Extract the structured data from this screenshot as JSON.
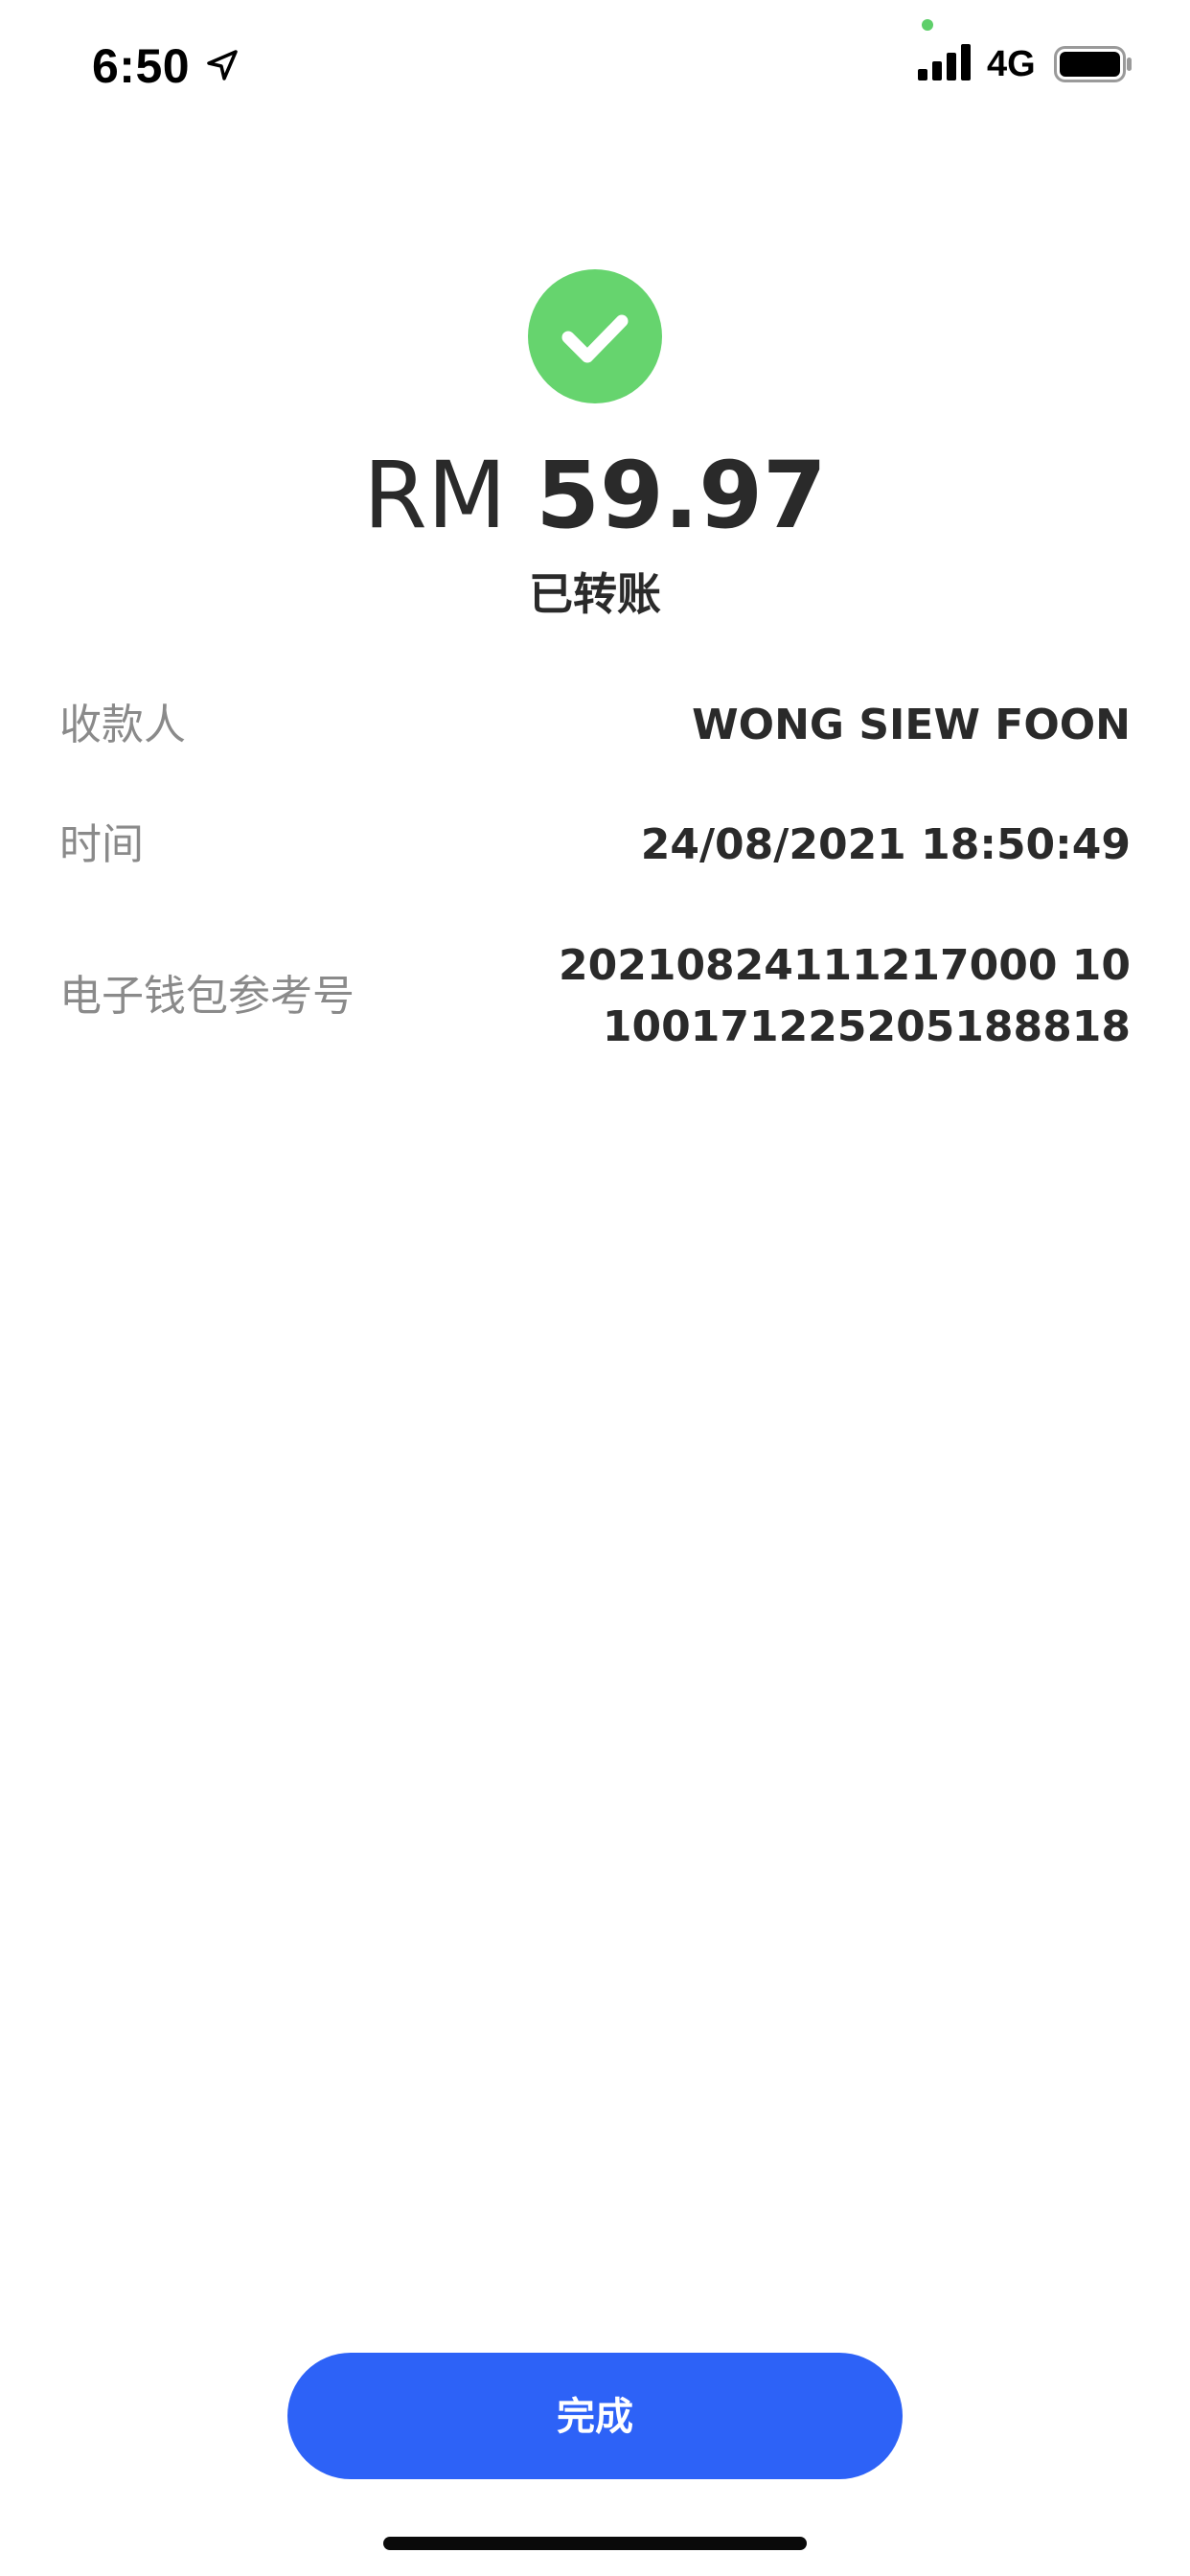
{
  "status_bar": {
    "time": "6:50",
    "network": "4G",
    "icons": [
      "location-arrow-icon",
      "signal-bars-icon",
      "battery-icon"
    ]
  },
  "receipt": {
    "icon": "check-icon",
    "accent_color": "#66d46e",
    "currency": "RM",
    "amount": "59.97",
    "status": "已转账",
    "recipient_label": "收款人",
    "recipient_value": "WONG SIEW FOON",
    "time_label": "时间",
    "time_value": "24/08/2021 18:50:49",
    "reference_label": "电子钱包参考号",
    "reference_line1": "20210824111217000 10",
    "reference_line2": "100171225205188818"
  },
  "actions": {
    "done_label": "完成",
    "button_color": "#2d62f7"
  }
}
